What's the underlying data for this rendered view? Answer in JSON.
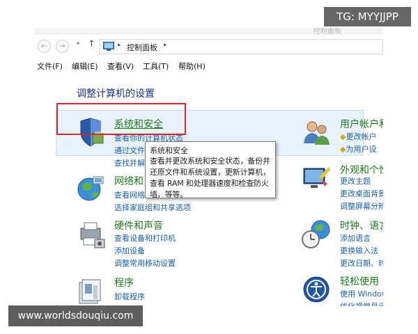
{
  "titlebar": {
    "ghost_text": "控制面板"
  },
  "address_bar": {
    "back": "←",
    "forward": "→",
    "up": "↑",
    "separator": "▸",
    "path": "控制面板",
    "trail_separator": "▸"
  },
  "menu": {
    "file": "文件(F)",
    "edit": "编辑(E)",
    "view": "查看(V)",
    "tools": "工具(T)",
    "help": "帮助(H)"
  },
  "heading": "调整计算机的设置",
  "categories": {
    "system_security": {
      "title": "系统和安全",
      "links": [
        "查看你的计算机状态",
        "通过文件",
        "查找并解"
      ]
    },
    "network": {
      "title": "网络和",
      "links": [
        "查看网络",
        "选择家庭组和共享选项"
      ]
    },
    "hardware": {
      "title": "硬件和声音",
      "links": [
        "查看设备和打印机",
        "添加设备",
        "调整常用移动设置"
      ]
    },
    "programs": {
      "title": "程序",
      "links": [
        "卸载程序"
      ]
    },
    "user_accounts": {
      "title": "用户帐户和",
      "links": [
        "更改帐户",
        "为用户设"
      ]
    },
    "appearance": {
      "title": "外观和个性",
      "links": [
        "更改主题",
        "更改桌面背景",
        "调整屏幕分辨"
      ]
    },
    "clock": {
      "title": "时钟、语言",
      "links": [
        "添加语言",
        "更换输入法",
        "更改日期、时"
      ]
    },
    "ease": {
      "title": "轻松使用",
      "links": [
        "使用 Window",
        "优化视觉显示"
      ]
    }
  },
  "tooltip": {
    "title": "系统和安全",
    "lines": [
      "查看并更改系统和安全状态，备份并",
      "还原文件和系统设置，更新计算机，",
      "查看 RAM 和处理器速度和检查防火",
      "墙，等等。"
    ]
  },
  "watermarks": {
    "tg": "TG: MYYJJPP",
    "url": "www.worldsdouqiu.com"
  },
  "colors": {
    "category_title": "#1e7a1e",
    "link": "#1a5fb4",
    "heading": "#1e3287",
    "highlight_border": "#d8262d"
  }
}
